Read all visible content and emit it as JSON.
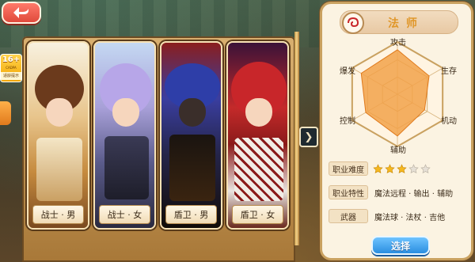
{
  "age_badge": {
    "age": "16+",
    "cadpa": "CADPA",
    "tip": "适龄提示"
  },
  "cards": [
    {
      "label": "战士 · 男"
    },
    {
      "label": "战士 · 女"
    },
    {
      "label": "盾卫 · 男"
    },
    {
      "label": "盾卫 · 女"
    }
  ],
  "panel": {
    "class_title": "法 师",
    "radar": {
      "axes": [
        {
          "label": "攻击",
          "value": 0.85
        },
        {
          "label": "生存",
          "value": 0.7
        },
        {
          "label": "机动",
          "value": 0.6
        },
        {
          "label": "辅助",
          "value": 0.8
        },
        {
          "label": "控制",
          "value": 0.7
        },
        {
          "label": "爆发",
          "value": 0.8
        }
      ],
      "fill_color": "#f2a24a"
    },
    "difficulty": {
      "label": "职业难度",
      "stars_filled": 3,
      "stars_total": 5
    },
    "traits": {
      "label": "职业特性",
      "value": "魔法远程 · 输出 · 辅助"
    },
    "weapon": {
      "label": "武器",
      "value": "魔法球 · 法杖 · 吉他"
    },
    "select_label": "选择"
  },
  "colors": {
    "accent": "#e0972a",
    "select_button": "#2a8ee0",
    "back_button": "#e04a3c"
  }
}
